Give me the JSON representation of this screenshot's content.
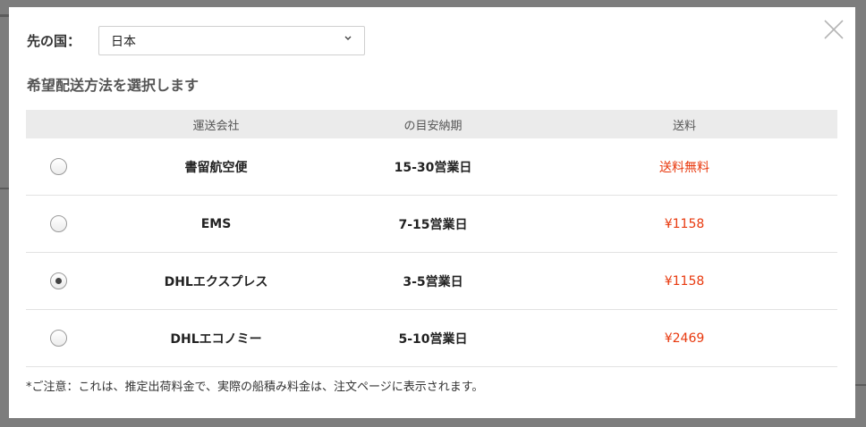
{
  "destination": {
    "label": "先の国：",
    "selected": "日本"
  },
  "heading": "希望配送方法を選択します",
  "table": {
    "headers": {
      "carrier": "運送会社",
      "time": "の目安納期",
      "fee": "送料"
    },
    "rows": [
      {
        "carrier": "書留航空便",
        "time": "15-30営業日",
        "fee": "送料無料",
        "selected": false
      },
      {
        "carrier": "EMS",
        "time": "7-15営業日",
        "fee": "¥1158",
        "selected": false
      },
      {
        "carrier": "DHLエクスプレス",
        "time": "3-5営業日",
        "fee": "¥1158",
        "selected": true
      },
      {
        "carrier": "DHLエコノミー",
        "time": "5-10営業日",
        "fee": "¥2469",
        "selected": false
      }
    ]
  },
  "note": "*ご注意：これは、推定出荷料金で、実際の船積み料金は、注文ページに表示されます。",
  "icons": {
    "close": "close-icon",
    "dropdown": "chevron-down-icon"
  },
  "colors": {
    "price": "#e8380d",
    "header_bg": "#ebebeb",
    "overlay": "#7d7d7d"
  }
}
